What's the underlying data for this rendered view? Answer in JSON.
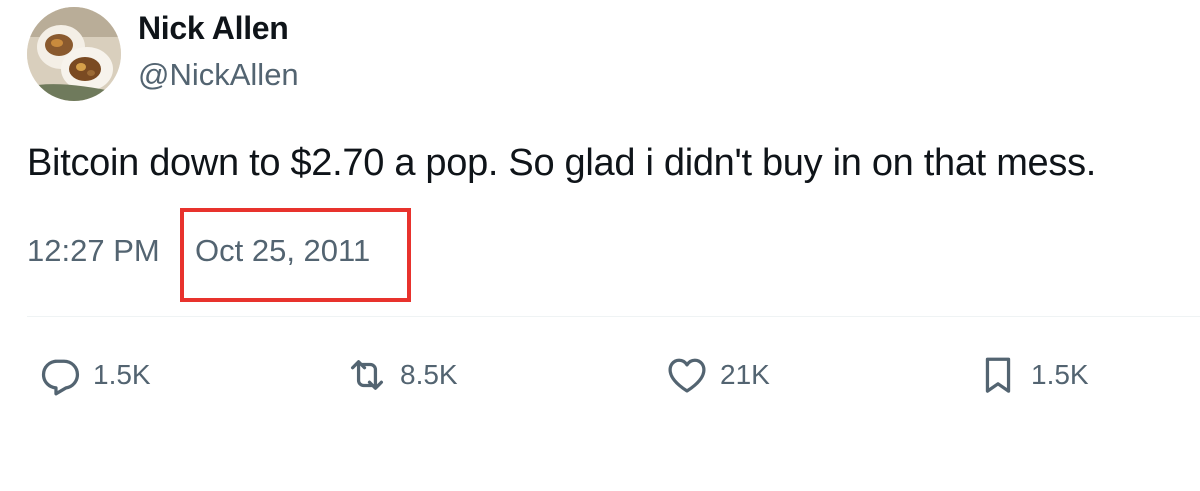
{
  "author": {
    "display_name": "Nick Allen",
    "handle": "@NickAllen"
  },
  "tweet": {
    "text": "Bitcoin down to $2.70 a pop. So glad i didn't buy in on that mess.",
    "time": "12:27 PM",
    "date": "Oct 25, 2011"
  },
  "actions": {
    "reply": {
      "icon": "reply-icon",
      "count": "1.5K"
    },
    "retweet": {
      "icon": "retweet-icon",
      "count": "8.5K"
    },
    "like": {
      "icon": "heart-icon",
      "count": "21K"
    },
    "bookmark": {
      "icon": "bookmark-icon",
      "count": "1.5K"
    }
  },
  "colors": {
    "text": "#0f1419",
    "secondary_text": "#536471",
    "highlight_border": "#e8322d",
    "divider": "#eff3f4"
  }
}
